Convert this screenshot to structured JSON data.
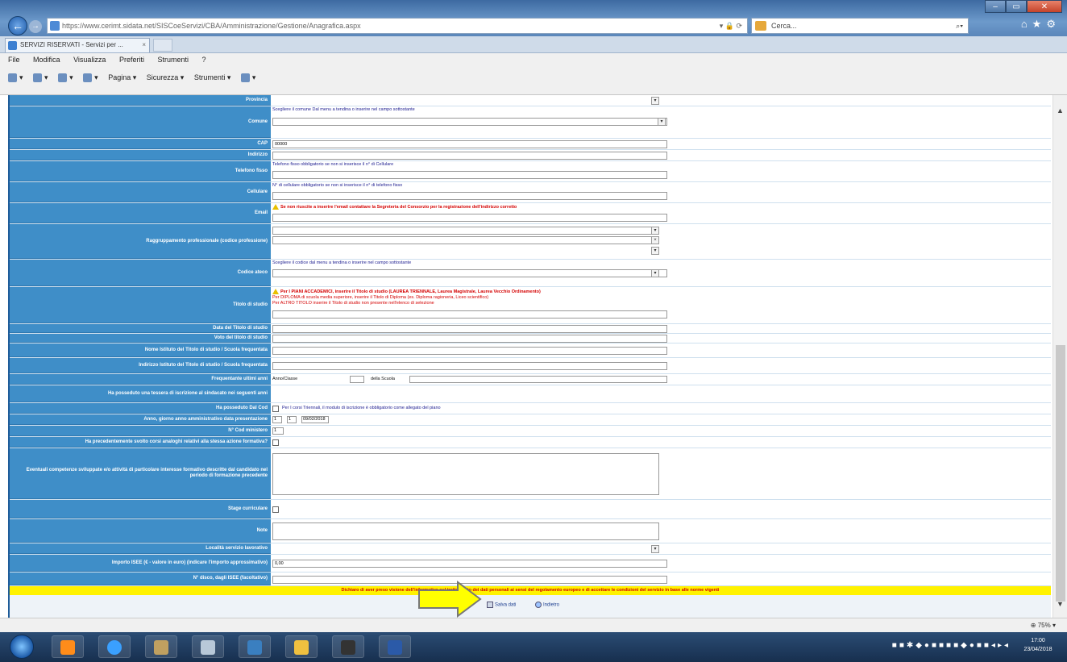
{
  "window": {
    "address": "https://www.cerimt.sidata.net/SISCoeServizi/CBA/Amministrazione/Gestione/Anagrafica.aspx",
    "address_host": "sidata.net",
    "search_placeholder": "Cerca...",
    "tab_title": "SERVIZI RISERVATI - Servizi per ...",
    "min": "–",
    "max": "▭",
    "close": "✕"
  },
  "menu": [
    "File",
    "Modifica",
    "Visualizza",
    "Preferiti",
    "Strumenti",
    "?"
  ],
  "commands": [
    "Pagina ▾",
    "Sicurezza ▾",
    "Strumenti ▾"
  ],
  "form": {
    "rows": [
      {
        "label": "Provincia",
        "note": ""
      },
      {
        "label": "Comune",
        "note": "Scegliere il comune Dal menu a tendina o inserire nel campo sottostante"
      },
      {
        "label": "CAP",
        "value": "00000"
      },
      {
        "label": "Indirizzo",
        "value": ""
      },
      {
        "label": "Telefono fisso",
        "note": "Telefono fisso obbligatorio se non si inserisce il n° di Cellulare"
      },
      {
        "label": "Cellulare",
        "note": "N° di cellulare obbligatorio se non si inserisce il n° di telefono fisso"
      },
      {
        "label": "Email",
        "note": "Se non riuscite a inserire l'email contattare la Segreteria del Consorzio per la registrazione dell'indirizzo corretto"
      },
      {
        "label": "Raggruppamento professionale (codice professione)",
        "note": ""
      },
      {
        "label": "Codice ateco",
        "note": "Scegliere il codice dal menu a tendina o inserire nel campo sottostante"
      },
      {
        "label": "Titolo di studio",
        "note1": "Per I PIANI ACCADEMICI, inserire il Titolo di studio (LAUREA TRIENNALE, Laurea Magistrale, Laurea Vecchio Ordinamento)",
        "note2": "Per DIPLOMA di scuola media superiore, inserire il Titolo di Diploma (es. Diploma ragioneria, Liceo scientifico)",
        "note3": "Per ALTRO TITOLO inserire il Titolo di studio non presente nell'elenco di selezione"
      },
      {
        "label": "Data del Titolo di studio"
      },
      {
        "label": "Voto del titolo di studio"
      },
      {
        "label": "Nome Istituto del Titolo di studio / Scuola frequentata"
      },
      {
        "label": "Indirizzo Istituto del Titolo di studio / Scuola frequentata"
      },
      {
        "label": "Frequentante ultimi anni",
        "c1": "Anno/Classe",
        "c2": "della Scuola"
      },
      {
        "label": "Ha posseduto una tessera di iscrizione al sindacato nei seguenti anni"
      },
      {
        "label": "Ha posseduto Dal Cod",
        "note": "Per I corsi Triennali, il modulo di iscrizione è obbligatorio come allegato del piano"
      },
      {
        "label": "Anno, giorno anno amministrativo data presentazione",
        "d1": "1",
        "d2": "1",
        "d3": "09/02/2018"
      },
      {
        "label": "N° Cod ministero",
        "value": "1"
      },
      {
        "label": "Ha precedentemente svolto corsi analoghi relativi alla stessa azione formativa?"
      },
      {
        "label": "Eventuali competenze sviluppate e/o attività di particolare interesse formativo descritte dal candidato nel periodo di formazione precedente"
      },
      {
        "label": "Stage curriculare"
      },
      {
        "label": "Note"
      },
      {
        "label": "Località servizio lavorativo"
      },
      {
        "label": "Importo ISEE (€ - valore in euro) (indicare l'importo approssimativo)",
        "value": "0,00"
      },
      {
        "label": "N° disco, dagli ISEE (facoltativo)"
      }
    ],
    "notice": "Dichiaro di aver preso visione dell'informativa sul trattamento dei dati personali ai sensi del regolamento europeo e di accettare le condizioni del servizio in base alle norme vigenti",
    "save": "Salva dati",
    "back": "Indietro"
  },
  "status": {
    "zoom": "75%"
  },
  "taskbar": {
    "time": "17:00",
    "date": "23/04/2018"
  },
  "colors": {
    "label_bg": "#3f8ec8",
    "notice_bg": "#fff200",
    "arrow": "#ffff00"
  }
}
